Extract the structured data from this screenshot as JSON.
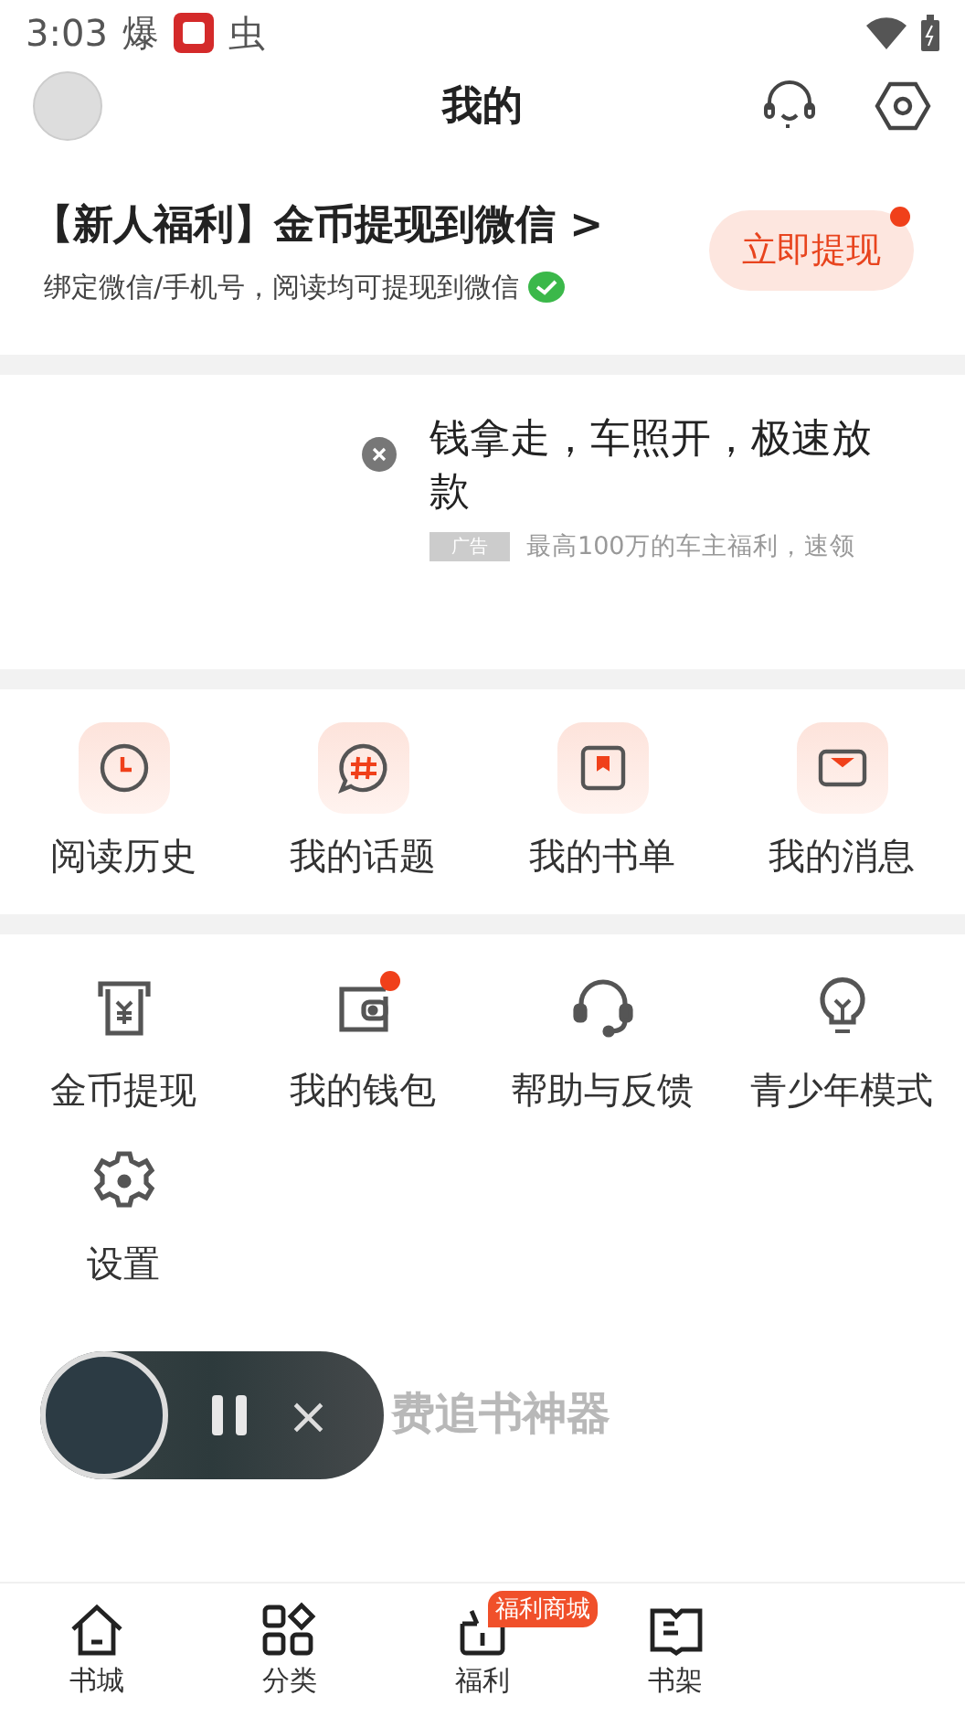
{
  "status_bar": {
    "time": "3:03",
    "notifications": [
      "爆",
      "虫"
    ]
  },
  "header": {
    "title": "我的"
  },
  "welfare": {
    "title": "【新人福利】金币提现到微信",
    "arrow": ">",
    "subtitle": "绑定微信/手机号，阅读均可提现到微信",
    "button": "立即提现",
    "badge_dot": true
  },
  "ad": {
    "headline": "钱拿走，车照开，极速放款",
    "tag": "广告",
    "description": "最高100万的车主福利，速领"
  },
  "quick_links": [
    {
      "label": "阅读历史",
      "kind": "clock"
    },
    {
      "label": "我的话题",
      "kind": "topic"
    },
    {
      "label": "我的书单",
      "kind": "booklist"
    },
    {
      "label": "我的消息",
      "kind": "message"
    }
  ],
  "tools": [
    {
      "label": "金币提现",
      "kind": "cash",
      "dot": false
    },
    {
      "label": "我的钱包",
      "kind": "wallet",
      "dot": true
    },
    {
      "label": "帮助与反馈",
      "kind": "headset",
      "dot": false
    },
    {
      "label": "青少年模式",
      "kind": "bulb",
      "dot": false
    },
    {
      "label": "设置",
      "kind": "gear",
      "dot": false
    }
  ],
  "slogan": "费追书神器",
  "player": {
    "playing": true,
    "close": "×"
  },
  "bottom_nav": [
    {
      "label": "书城",
      "kind": "home",
      "selected": false
    },
    {
      "label": "分类",
      "kind": "grid",
      "selected": false
    },
    {
      "label": "福利",
      "kind": "gift",
      "selected": false,
      "badge": "福利商城"
    },
    {
      "label": "书架",
      "kind": "book",
      "selected": false
    }
  ]
}
